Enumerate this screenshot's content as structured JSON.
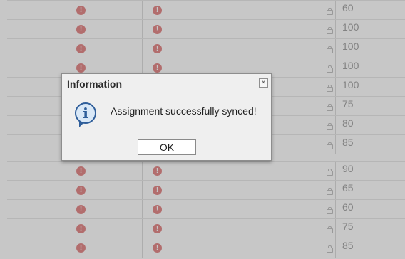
{
  "dialog": {
    "title": "Information",
    "message": "Assignment successfully synced!",
    "ok_label": "OK",
    "close_icon": "close-icon",
    "info_icon": "info-icon"
  },
  "grid": {
    "alert_icon": "exclamation-circle-icon",
    "lock_icon": "lock-icon",
    "scores": [
      "60",
      "100",
      "100",
      "100",
      "100",
      "75",
      "80",
      "85",
      "90",
      "65",
      "60",
      "75",
      "85"
    ]
  },
  "colors": {
    "alert": "#e58c8c",
    "overlay": "rgba(0,0,0,0.22)"
  }
}
